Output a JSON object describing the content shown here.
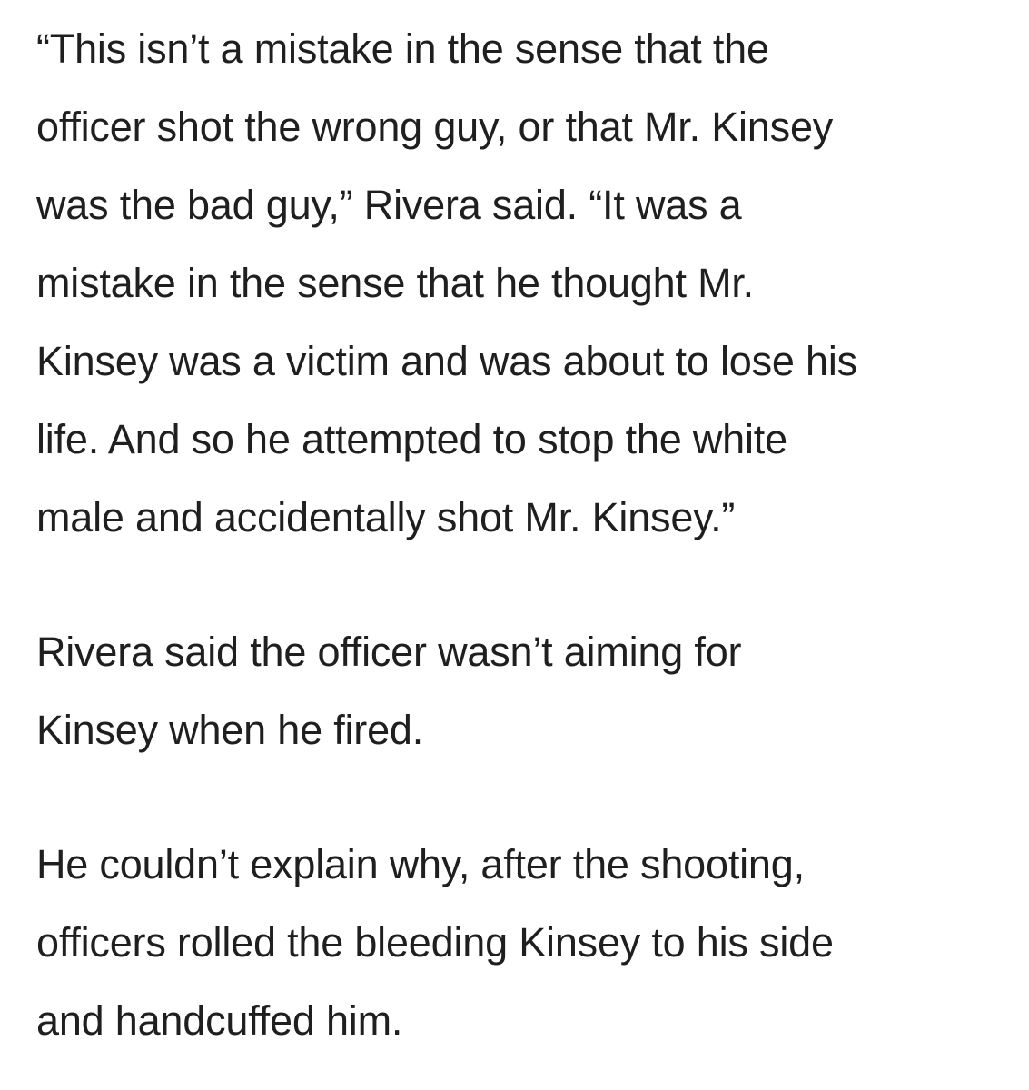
{
  "article": {
    "paragraphs": [
      {
        "lines": [
          "“This isn’t a mistake in the sense that the",
          "officer shot the wrong guy, or that Mr. Kinsey",
          "was the bad guy,” Rivera said. “It was a",
          "mistake in the sense that he thought Mr.",
          "Kinsey was a victim and was about to lose his",
          "life. And so he attempted to stop the white",
          "male and accidentally shot Mr. Kinsey.”"
        ]
      },
      {
        "lines": [
          "Rivera said the officer wasn’t aiming for",
          "Kinsey when he fired."
        ]
      },
      {
        "lines": [
          "He couldn’t explain why, after the shooting,",
          "officers rolled the bleeding Kinsey to his side",
          "and handcuffed him."
        ]
      }
    ]
  }
}
